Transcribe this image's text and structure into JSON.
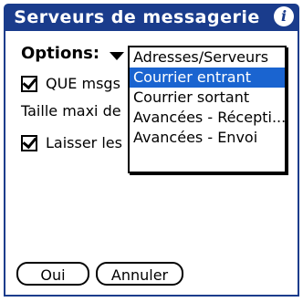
{
  "header": {
    "title": "Serveurs de messagerie",
    "info_glyph": "i",
    "info_icon": "info-icon"
  },
  "options": {
    "label": "Options:",
    "menu": [
      {
        "label": "Adresses/Serveurs",
        "selected": false
      },
      {
        "label": "Courrier entrant",
        "selected": true
      },
      {
        "label": "Courrier sortant",
        "selected": false
      },
      {
        "label": "Avancées - Récepti...",
        "selected": false
      },
      {
        "label": "Avancées - Envoi",
        "selected": false
      }
    ]
  },
  "form": {
    "que_msgs_label": "QUE msgs",
    "que_msgs_checked": true,
    "taille_label": "Taille maxi de",
    "laisser_label": "Laisser les",
    "laisser_checked": true
  },
  "buttons": {
    "ok_label": "Oui",
    "cancel_label": "Annuler"
  },
  "colors": {
    "titlebar": "#1a3c8c",
    "selection": "#1a64d0"
  }
}
